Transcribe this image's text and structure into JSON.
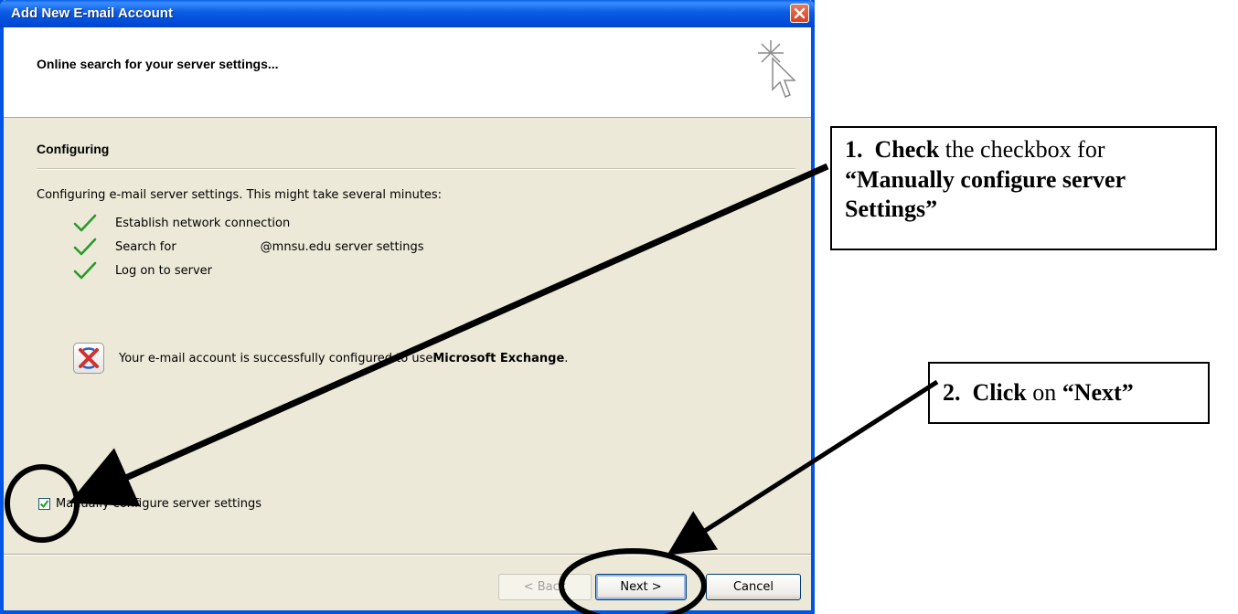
{
  "window": {
    "title": "Add New E-mail Account",
    "close_label": "×"
  },
  "header": {
    "title": "Online search for your server settings..."
  },
  "main": {
    "section_title": "Configuring",
    "description": "Configuring e-mail server settings. This might take several minutes:",
    "steps": [
      {
        "label": "Establish network connection"
      },
      {
        "label": "Search for",
        "suffix": "@mnsu.edu server settings"
      },
      {
        "label": "Log on to server"
      }
    ],
    "result_text": "Your e-mail account is successfully configured to use ",
    "result_bold": "Microsoft Exchange",
    "result_end": ".",
    "manual_checkbox": {
      "label": "Manually configure server settings",
      "checked": true
    }
  },
  "buttons": {
    "back": "< Back",
    "next": "Next >",
    "cancel": "Cancel"
  },
  "annotations": {
    "callout1": {
      "number": "1.",
      "bold": "Check",
      "text": " the checkbox for ",
      "quote": "“Manually configure server Settings”"
    },
    "callout2": {
      "number": "2.",
      "bold": "Click",
      "text": " on ",
      "quote": "“Next”"
    }
  },
  "colors": {
    "titlebar": "#0054e3",
    "check": "#2a9a2a",
    "face": "#ece9d8"
  }
}
